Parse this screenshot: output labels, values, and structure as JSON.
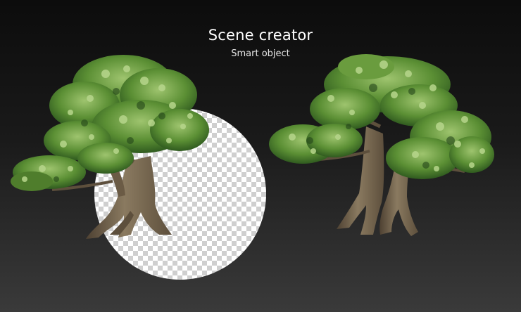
{
  "header": {
    "title": "Scene creator",
    "subtitle": "Smart object"
  },
  "scene": {
    "transparency_pattern": "checkerboard",
    "objects": [
      "tree-left",
      "tree-right"
    ],
    "colors": {
      "background_top": "#0c0c0c",
      "background_bottom": "#3a3a3a",
      "leaf_dark": "#2f5a1f",
      "leaf_mid": "#5b8f34",
      "leaf_light": "#a6c97a",
      "trunk": "#7d6b52",
      "trunk_shadow": "#4e4132"
    }
  }
}
